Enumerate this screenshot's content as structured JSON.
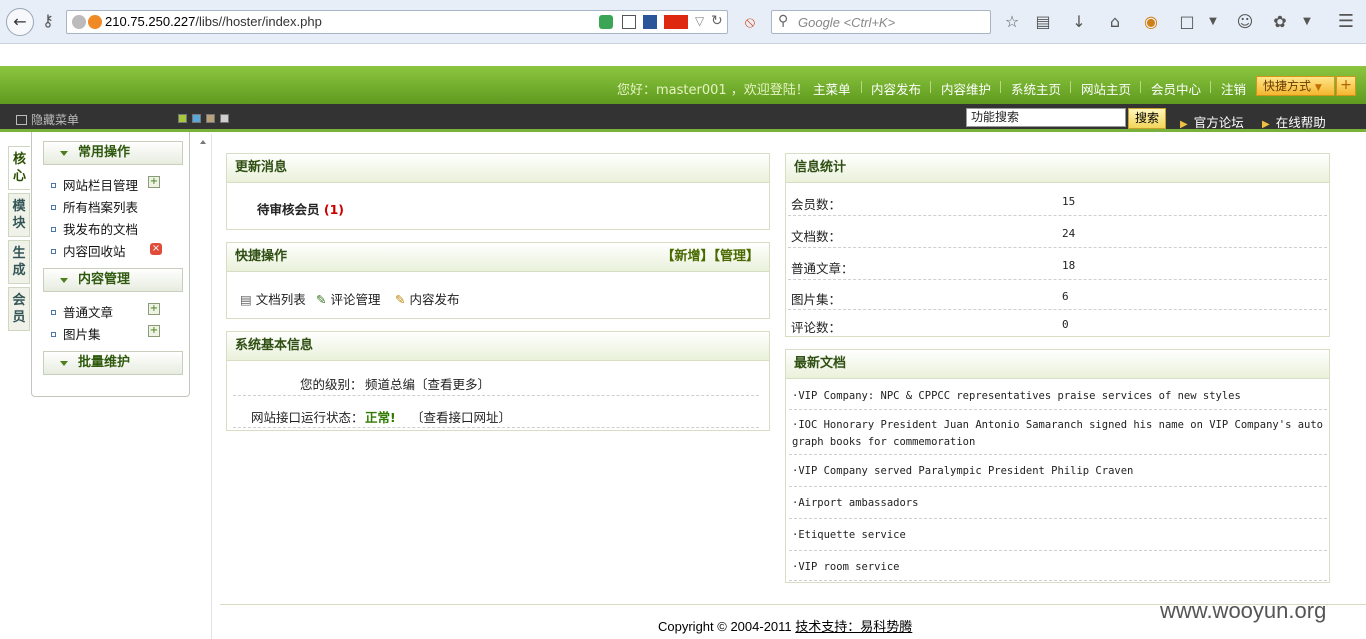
{
  "browser": {
    "url_host": "210.75.250.227",
    "url_path": "/libs//hoster/index.php",
    "search_placeholder": "Google <Ctrl+K>"
  },
  "header": {
    "greeting": "您好：master001 ，欢迎登陆！",
    "links": [
      "主菜单",
      "内容发布",
      "内容维护",
      "系统主页",
      "网站主页",
      "会员中心",
      "注销"
    ],
    "quick_button": "快捷方式",
    "quick_plus": "+"
  },
  "toolbar": {
    "hide_menu": "隐藏菜单",
    "skin_colors": [
      "#a7c83d",
      "#5aa7d9",
      "#b9a27a",
      "#cfcfcf"
    ],
    "search_value": "功能搜索",
    "search_button": "搜索",
    "forum": "官方论坛",
    "help": "在线帮助"
  },
  "side_tabs": [
    "核心",
    "模块",
    "生成",
    "会员"
  ],
  "left_menu": {
    "group1": "常用操作",
    "group1_items": [
      "网站栏目管理",
      "所有档案列表",
      "我发布的文档",
      "内容回收站"
    ],
    "group2": "内容管理",
    "group2_items": [
      "普通文章",
      "图片集"
    ],
    "group3": "批量维护"
  },
  "updates": {
    "title": "更新消息",
    "pending_label": "待审核会员",
    "pending_count": "(1)"
  },
  "quick_ops": {
    "title": "快捷操作",
    "add_link": "【新增】",
    "manage_link": "【管理】",
    "items": [
      "文档列表",
      "评论管理",
      "内容发布"
    ]
  },
  "sysinfo": {
    "title": "系统基本信息",
    "level_label": "您的级别：",
    "level_value": "频道总编",
    "level_more": "〔查看更多〕",
    "api_label": "网站接口运行状态：",
    "api_status": "正常!",
    "api_link": "〔查看接口网址〕"
  },
  "stats": {
    "title": "信息统计",
    "rows": [
      {
        "label": "会员数：",
        "value": "15"
      },
      {
        "label": "文档数：",
        "value": "24"
      },
      {
        "label": "普通文章：",
        "value": "18"
      },
      {
        "label": "图片集：",
        "value": "6"
      },
      {
        "label": "评论数：",
        "value": "0"
      }
    ]
  },
  "latest": {
    "title": "最新文档",
    "items": [
      "·VIP Company: NPC & CPPCC representatives praise services of new styles",
      "·IOC Honorary President Juan Antonio Samaranch signed his name on VIP Company's autograph books for commemoration",
      "·VIP Company served Paralympic President Philip Craven",
      "·Airport ambassadors",
      "·Etiquette service",
      "·VIP room service"
    ]
  },
  "footer": {
    "copyright": "Copyright © 2004-2011",
    "support": "技术支持：易科势腾",
    "watermark": "www.wooyun.org"
  }
}
